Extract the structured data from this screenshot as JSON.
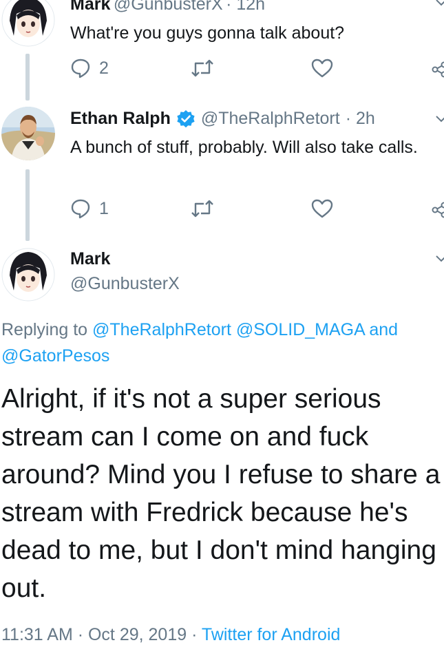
{
  "tweet1": {
    "name": "Mark",
    "handle": "@GunbusterX",
    "time": "· 12h",
    "text": "What're you guys gonna talk about?",
    "reply_count": "2"
  },
  "tweet2": {
    "name": "Ethan Ralph",
    "handle": "@TheRalphRetort",
    "time": "· 2h",
    "text": "A bunch of stuff, probably. Will also take calls.",
    "reply_count": "1"
  },
  "main": {
    "name": "Mark",
    "handle": "@GunbusterX",
    "replying_prefix": "Replying to",
    "replying_to_1": "@TheRalphRetort",
    "replying_to_2": "@SOLID_MAGA",
    "replying_and": "and",
    "replying_to_3": "@GatorPesos",
    "text": "Alright, if it's not a super serious stream can I come on and fuck around? Mind you I refuse to share a stream with Fredrick because he's dead to me, but I don't mind hanging out.",
    "timestamp": "11:31 AM · Oct 29, 2019 ·",
    "source": "Twitter for Android"
  },
  "colors": {
    "accent": "#1da1f2",
    "muted": "#657786",
    "text": "#14171a",
    "thread_line": "#ccd6dd",
    "verified": "#1da1f2"
  },
  "icons": [
    "reply-icon",
    "retweet-icon",
    "like-icon",
    "share-icon",
    "chevron-down-icon",
    "verified-badge-icon"
  ]
}
